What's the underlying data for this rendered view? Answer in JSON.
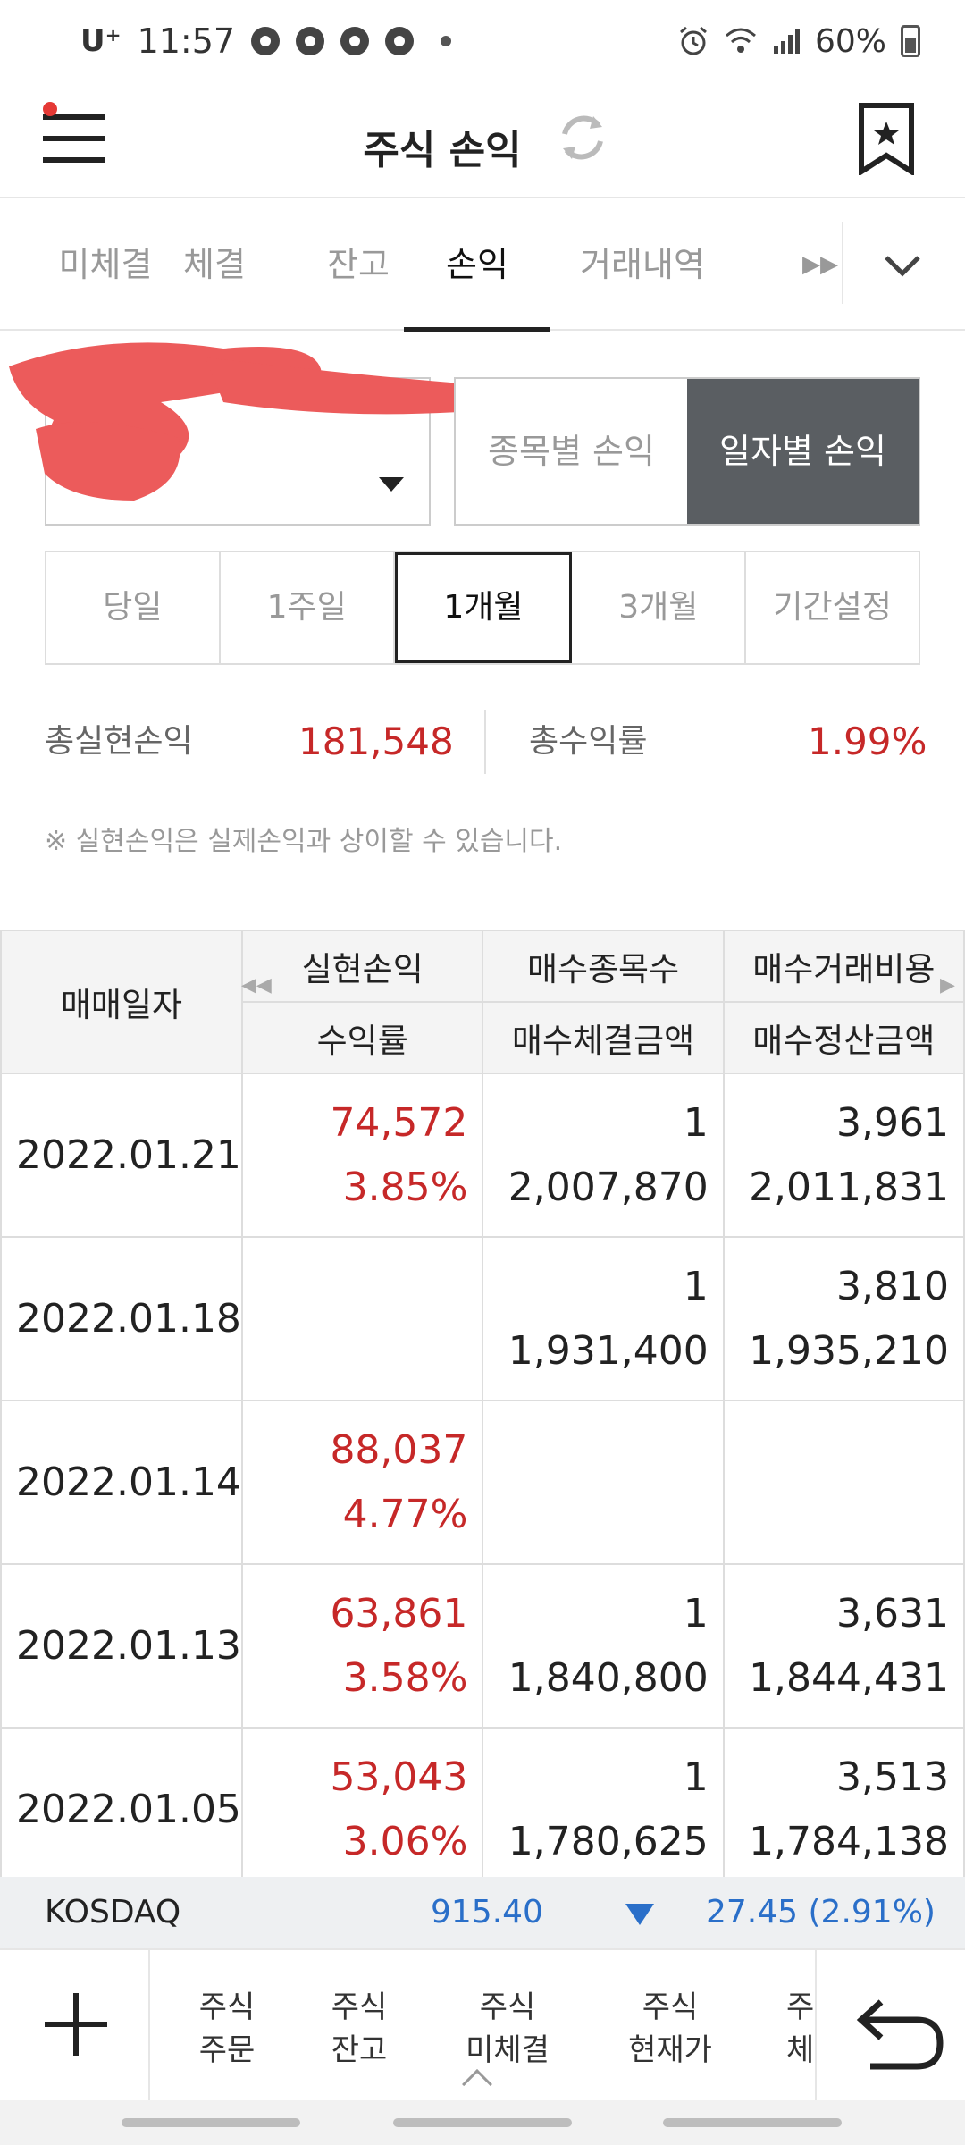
{
  "status_bar": {
    "carrier": "U⁺",
    "time": "11:57",
    "battery": "60%"
  },
  "header": {
    "title": "주식 손익"
  },
  "tabs": [
    {
      "label": "미체결",
      "active": false
    },
    {
      "label": "체결",
      "active": false
    },
    {
      "label": "잔고",
      "active": false
    },
    {
      "label": "손익",
      "active": true
    },
    {
      "label": "거래내역",
      "active": false
    }
  ],
  "view_toggle": {
    "by_stock": "종목별 손익",
    "by_date": "일자별 손익"
  },
  "periods": [
    {
      "label": "당일",
      "active": false
    },
    {
      "label": "1주일",
      "active": false
    },
    {
      "label": "1개월",
      "active": true
    },
    {
      "label": "3개월",
      "active": false
    },
    {
      "label": "기간설정",
      "active": false
    }
  ],
  "summary": {
    "realized_label": "총실현손익",
    "realized_value": "181,548",
    "return_label": "총수익률",
    "return_value": "1.99%"
  },
  "note": "※ 실현손익은 실제손익과 상이할 수 있습니다.",
  "table": {
    "headers": {
      "date": "매매일자",
      "col1_top": "실현손익",
      "col1_bottom": "수익률",
      "col2_top": "매수종목수",
      "col2_bottom": "매수체결금액",
      "col3_top": "매수거래비용",
      "col3_bottom": "매수정산금액"
    },
    "rows": [
      {
        "date": "2022.01.21",
        "pnl": "74,572",
        "rate": "3.85%",
        "buy_count": "1",
        "buy_amount": "2,007,870",
        "buy_cost": "3,961",
        "settle_amount": "2,011,831"
      },
      {
        "date": "2022.01.18",
        "pnl": "",
        "rate": "",
        "buy_count": "1",
        "buy_amount": "1,931,400",
        "buy_cost": "3,810",
        "settle_amount": "1,935,210"
      },
      {
        "date": "2022.01.14",
        "pnl": "88,037",
        "rate": "4.77%",
        "buy_count": "",
        "buy_amount": "",
        "buy_cost": "",
        "settle_amount": ""
      },
      {
        "date": "2022.01.13",
        "pnl": "63,861",
        "rate": "3.58%",
        "buy_count": "1",
        "buy_amount": "1,840,800",
        "buy_cost": "3,631",
        "settle_amount": "1,844,431"
      },
      {
        "date": "2022.01.05",
        "pnl": "53,043",
        "rate": "3.06%",
        "buy_count": "1",
        "buy_amount": "1,780,625",
        "buy_cost": "3,513",
        "settle_amount": "1,784,138"
      }
    ]
  },
  "ticker": {
    "name": "KOSDAQ",
    "value": "915.40",
    "change": "27.45 (2.91%)",
    "direction": "down",
    "color": "#2a6fc9"
  },
  "bottom_nav": [
    {
      "line1": "주식",
      "line2": "주문"
    },
    {
      "line1": "주식",
      "line2": "잔고"
    },
    {
      "line1": "주식",
      "line2": "미체결"
    },
    {
      "line1": "주식",
      "line2": "현재가"
    },
    {
      "line1": "주",
      "line2": "체"
    }
  ],
  "colors": {
    "profit": "#c62828",
    "accent_dark": "#5a5e62",
    "notification": "#e53935"
  }
}
